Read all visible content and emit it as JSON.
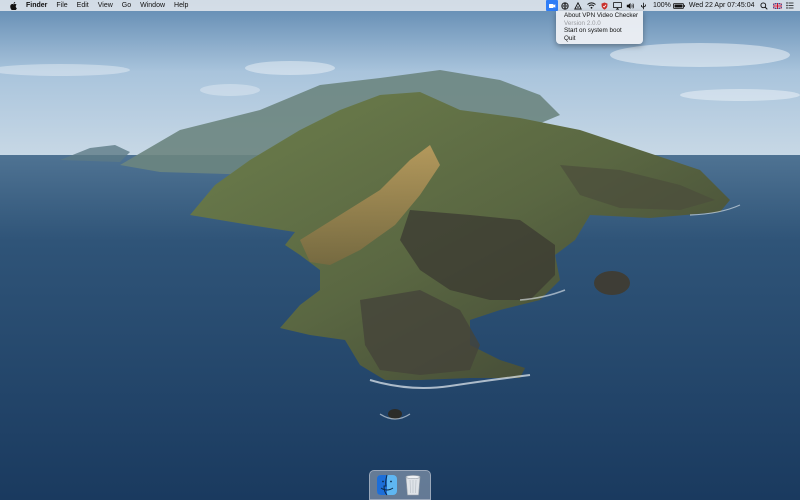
{
  "menubar": {
    "app_name": "Finder",
    "menus": [
      "File",
      "Edit",
      "View",
      "Go",
      "Window",
      "Help"
    ]
  },
  "status": {
    "battery_percent": "100%",
    "clock": "Wed 22 Apr  07:45:04"
  },
  "vpn_menu": {
    "items": [
      {
        "label": "About VPN Video Checker",
        "enabled": true
      },
      {
        "label": "Version 2.0.0",
        "enabled": false
      },
      {
        "label": "Start on system boot",
        "enabled": true
      },
      {
        "label": "Quit",
        "enabled": true
      }
    ]
  },
  "dock": {
    "apps": [
      {
        "icon": "finder-icon"
      },
      {
        "icon": "trash-icon"
      }
    ]
  },
  "colors": {
    "accent": "#2f7df6",
    "menubar_bg": "#eceef2",
    "sea": "#24476d",
    "sky": "#a9c4dc"
  }
}
